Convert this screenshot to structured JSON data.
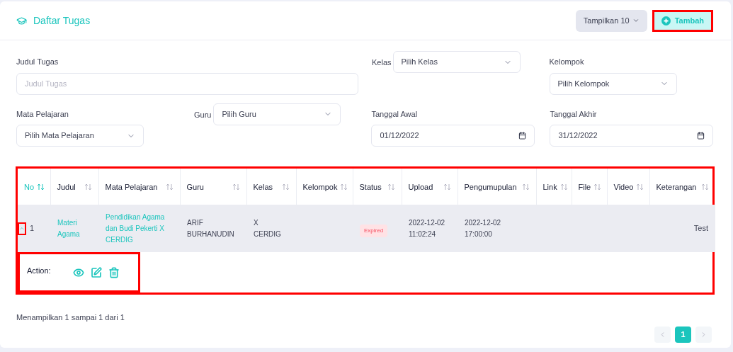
{
  "header": {
    "title": "Daftar Tugas",
    "page_size_button": "Tampilkan 10",
    "add_button": {
      "label": "Tambah",
      "highlighted": true
    }
  },
  "filters": {
    "judul": {
      "label": "Judul Tugas",
      "placeholder": "Judul Tugas"
    },
    "kelas": {
      "label": "Kelas",
      "value": "Pilih Kelas"
    },
    "kelompok": {
      "label": "Kelompok",
      "value": "Pilih Kelompok"
    },
    "mapel": {
      "label": "Mata Pelajaran",
      "value": "Pilih Mata Pelajaran"
    },
    "guru": {
      "label": "Guru",
      "value": "Pilih Guru"
    },
    "tanggal_awal": {
      "label": "Tanggal Awal",
      "value": "01/12/2022"
    },
    "tanggal_akhir": {
      "label": "Tanggal Akhir",
      "value": "31/12/2022"
    }
  },
  "table": {
    "highlighted": true,
    "columns": [
      {
        "label": "No",
        "selected": true
      },
      {
        "label": "Judul",
        "selected": false
      },
      {
        "label": "Mata Pelajaran",
        "selected": false
      },
      {
        "label": "Guru",
        "selected": false
      },
      {
        "label": "Kelas",
        "selected": false
      },
      {
        "label": "Kelompok",
        "selected": false
      },
      {
        "label": "Status",
        "selected": false
      },
      {
        "label": "Upload",
        "selected": false
      },
      {
        "label": "Pengumupulan",
        "selected": false
      },
      {
        "label": "Link",
        "selected": false
      },
      {
        "label": "File",
        "selected": false
      },
      {
        "label": "Video",
        "selected": false
      },
      {
        "label": "Keterangan",
        "selected": false
      }
    ],
    "rows": [
      {
        "expanded": true,
        "toggle_highlighted": true,
        "cells": [
          {
            "kind": "text",
            "text": "1"
          },
          {
            "kind": "link",
            "text": "Materi Agama"
          },
          {
            "kind": "link",
            "text": "Pendidikan Agama dan Budi Pekerti X CERDIG"
          },
          {
            "kind": "text",
            "text": "ARIF BURHANUDIN"
          },
          {
            "kind": "text",
            "text": "X\nCERDIG"
          },
          {
            "kind": "empty"
          },
          {
            "kind": "badge",
            "text": "Expired"
          },
          {
            "kind": "text",
            "text": "2022-12-02\n11:02:24"
          },
          {
            "kind": "text",
            "text": "2022-12-02\n17:00:00"
          },
          {
            "kind": "empty"
          },
          {
            "kind": "empty"
          },
          {
            "kind": "empty"
          },
          {
            "kind": "right",
            "text": "Test"
          }
        ],
        "action": {
          "label": "Action:",
          "highlighted": true
        }
      }
    ]
  },
  "footer": {
    "info": "Menampilkan 1 sampai 1 dari 1",
    "pages": [
      {
        "label": "1",
        "selected": true
      }
    ]
  }
}
